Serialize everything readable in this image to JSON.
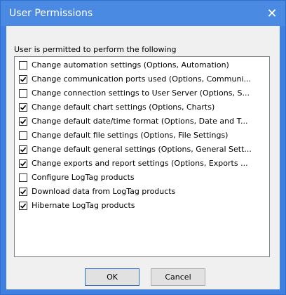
{
  "window": {
    "title": "User Permissions",
    "close_glyph": "✕",
    "accent_color": "#3f80e0"
  },
  "caption": "User is permitted to perform the following",
  "permissions": [
    {
      "label": "Change automation settings (Options, Automation)",
      "checked": false
    },
    {
      "label": "Change communication ports used (Options, Communi...",
      "checked": true
    },
    {
      "label": "Change connection settings to User Server (Options, S...",
      "checked": false
    },
    {
      "label": "Change default chart settings (Options, Charts)",
      "checked": true
    },
    {
      "label": "Change default date/time format (Options, Date and T...",
      "checked": true
    },
    {
      "label": "Change default file settings (Options, File Settings)",
      "checked": false
    },
    {
      "label": "Change default general settings (Options, General Sett...",
      "checked": true
    },
    {
      "label": "Change exports and report settings (Options, Exports ...",
      "checked": true
    },
    {
      "label": "Configure LogTag products",
      "checked": false
    },
    {
      "label": "Download data from LogTag products",
      "checked": true
    },
    {
      "label": "Hibernate LogTag products",
      "checked": true
    }
  ],
  "buttons": {
    "ok_label": "OK",
    "cancel_label": "Cancel"
  }
}
